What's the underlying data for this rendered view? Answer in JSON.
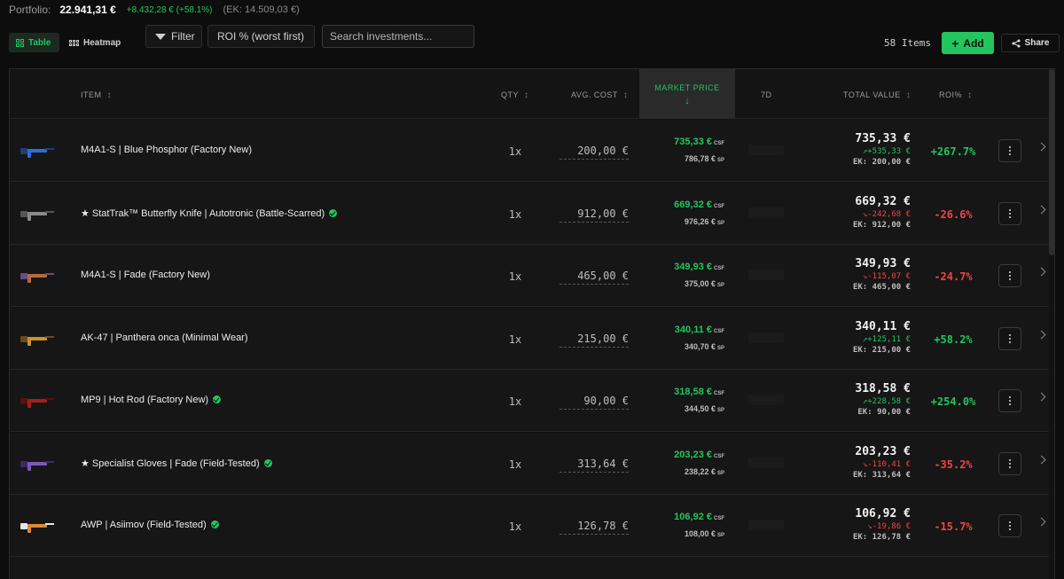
{
  "portfolio": {
    "label": "Portfolio:",
    "value": "22.941,31 €",
    "gain": "+8.432,28 € (+58.1%)",
    "ek": "(EK: 14.509,03 €)"
  },
  "toolbar": {
    "view_table": "Table",
    "view_heatmap": "Heatmap",
    "filter": "Filter",
    "sort_selected": "ROI % (worst first)",
    "search_placeholder": "Search investments...",
    "items_count": "58 Items",
    "add": "Add",
    "share": "Share"
  },
  "colors": {
    "accent": "#22c55e",
    "negative": "#ef4444",
    "background": "#0d0d0d"
  },
  "table": {
    "headers": {
      "item": "ITEM",
      "qty": "QTY",
      "avg_cost": "AVG. COST",
      "market_price": "MARKET PRICE",
      "market_price_sort": "↓",
      "seven_d": "7D",
      "total_value": "TOTAL VALUE",
      "roi": "ROI%"
    },
    "sort_glyph": "↕",
    "rows": [
      {
        "name": "M4A1-S | Blue Phosphor (Factory New)",
        "verified": false,
        "icon": "m4a1s-blue-icon",
        "qty": "1x",
        "avg": "200,00 €",
        "csf": "735,33 €",
        "sp": "786,78 €",
        "csf_tag": "CSF",
        "sp_tag": "SP",
        "total": "735,33 €",
        "change": "↗+535,33 €",
        "change_dir": "pos",
        "ek": "EK: 200,00 €",
        "roi": "+267.7%",
        "roi_dir": "pos"
      },
      {
        "name": "★ StatTrak™ Butterfly Knife | Autotronic (Battle-Scarred)",
        "verified": true,
        "icon": "butterfly-knife-icon",
        "qty": "1x",
        "avg": "912,00 €",
        "csf": "669,32 €",
        "sp": "976,26 €",
        "csf_tag": "CSF",
        "sp_tag": "SP",
        "total": "669,32 €",
        "change": "↘-242,68 €",
        "change_dir": "neg",
        "ek": "EK: 912,00 €",
        "roi": "-26.6%",
        "roi_dir": "neg"
      },
      {
        "name": "M4A1-S | Fade (Factory New)",
        "verified": false,
        "icon": "m4a1s-fade-icon",
        "qty": "1x",
        "avg": "465,00 €",
        "csf": "349,93 €",
        "sp": "375,00 €",
        "csf_tag": "CSF",
        "sp_tag": "SP",
        "total": "349,93 €",
        "change": "↘-115,07 €",
        "change_dir": "neg",
        "ek": "EK: 465,00 €",
        "roi": "-24.7%",
        "roi_dir": "neg"
      },
      {
        "name": "AK-47 | Panthera onca (Minimal Wear)",
        "verified": false,
        "icon": "ak47-icon",
        "qty": "1x",
        "avg": "215,00 €",
        "csf": "340,11 €",
        "sp": "340,70 €",
        "csf_tag": "CSF",
        "sp_tag": "SP",
        "total": "340,11 €",
        "change": "↗+125,11 €",
        "change_dir": "pos",
        "ek": "EK: 215,00 €",
        "roi": "+58.2%",
        "roi_dir": "pos"
      },
      {
        "name": "MP9 | Hot Rod (Factory New)",
        "verified": true,
        "icon": "mp9-icon",
        "qty": "1x",
        "avg": "90,00 €",
        "csf": "318,58 €",
        "sp": "344,50 €",
        "csf_tag": "CSF",
        "sp_tag": "SP",
        "total": "318,58 €",
        "change": "↗+228,58 €",
        "change_dir": "pos",
        "ek": "EK: 90,00 €",
        "roi": "+254.0%",
        "roi_dir": "pos"
      },
      {
        "name": "★ Specialist Gloves | Fade (Field-Tested)",
        "verified": true,
        "icon": "gloves-icon",
        "qty": "1x",
        "avg": "313,64 €",
        "csf": "203,23 €",
        "sp": "238,22 €",
        "csf_tag": "CSF",
        "sp_tag": "SP",
        "total": "203,23 €",
        "change": "↘-110,41 €",
        "change_dir": "neg",
        "ek": "EK: 313,64 €",
        "roi": "-35.2%",
        "roi_dir": "neg"
      },
      {
        "name": "AWP | Asiimov (Field-Tested)",
        "verified": true,
        "icon": "awp-icon",
        "qty": "1x",
        "avg": "126,78 €",
        "csf": "106,92 €",
        "sp": "108,00 €",
        "csf_tag": "CSF",
        "sp_tag": "SP",
        "total": "106,92 €",
        "change": "↘-19,86 €",
        "change_dir": "neg",
        "ek": "EK: 126,78 €",
        "roi": "-15.7%",
        "roi_dir": "neg"
      }
    ]
  }
}
